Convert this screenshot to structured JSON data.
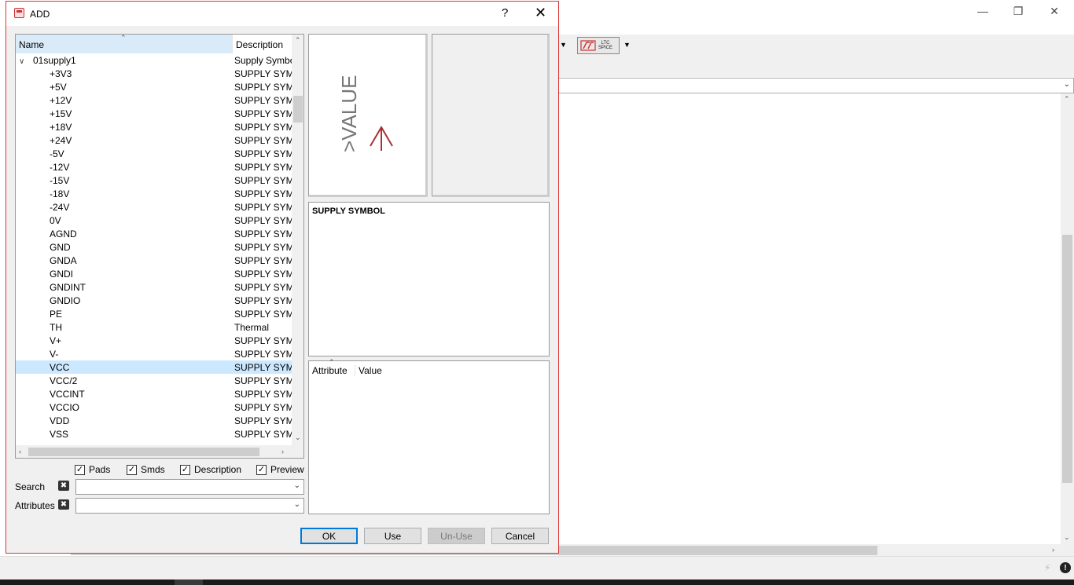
{
  "dialog": {
    "title": "ADD",
    "help_label": "?",
    "close_label": "✕"
  },
  "tree": {
    "columns": {
      "name": "Name",
      "description": "Description"
    },
    "root": {
      "name": "01supply1",
      "description": "Supply Symbols"
    },
    "items": [
      {
        "name": "+3V3",
        "description": "SUPPLY SYMBOL"
      },
      {
        "name": "+5V",
        "description": "SUPPLY SYMBOL"
      },
      {
        "name": "+12V",
        "description": "SUPPLY SYMBOL"
      },
      {
        "name": "+15V",
        "description": "SUPPLY SYMBOL"
      },
      {
        "name": "+18V",
        "description": "SUPPLY SYMBOL"
      },
      {
        "name": "+24V",
        "description": "SUPPLY SYMBOL"
      },
      {
        "name": "-5V",
        "description": "SUPPLY SYMBOL"
      },
      {
        "name": "-12V",
        "description": "SUPPLY SYMBOL"
      },
      {
        "name": "-15V",
        "description": "SUPPLY SYMBOL"
      },
      {
        "name": "-18V",
        "description": "SUPPLY SYMBOL"
      },
      {
        "name": "-24V",
        "description": "SUPPLY SYMBOL"
      },
      {
        "name": "0V",
        "description": "SUPPLY SYMBOL"
      },
      {
        "name": "AGND",
        "description": "SUPPLY SYMBOL"
      },
      {
        "name": "GND",
        "description": "SUPPLY SYMBOL"
      },
      {
        "name": "GNDA",
        "description": "SUPPLY SYMBOL"
      },
      {
        "name": "GNDI",
        "description": "SUPPLY SYMBOL"
      },
      {
        "name": "GNDINT",
        "description": "SUPPLY SYMBOL"
      },
      {
        "name": "GNDIO",
        "description": "SUPPLY SYMBOL"
      },
      {
        "name": "PE",
        "description": "SUPPLY SYMBOL"
      },
      {
        "name": "TH",
        "description": "Thermal"
      },
      {
        "name": "V+",
        "description": "SUPPLY SYMBOL"
      },
      {
        "name": "V-",
        "description": "SUPPLY SYMBOL"
      },
      {
        "name": "VCC",
        "description": "SUPPLY SYMBOL",
        "selected": true
      },
      {
        "name": "VCC/2",
        "description": "SUPPLY SYMBOL"
      },
      {
        "name": "VCCINT",
        "description": "SUPPLY SYMBOL"
      },
      {
        "name": "VCCIO",
        "description": "SUPPLY SYMBOL"
      },
      {
        "name": "VDD",
        "description": "SUPPLY SYMBOL"
      },
      {
        "name": "VSS",
        "description": "SUPPLY SYMBOL"
      }
    ]
  },
  "preview": {
    "symbol_text": ">VALUE",
    "symbol_color": "#a83232",
    "text_color": "#777777"
  },
  "description_text": "SUPPLY SYMBOL",
  "attributes": {
    "col_attribute": "Attribute",
    "col_value": "Value"
  },
  "options": {
    "pads": {
      "label": "Pads",
      "checked": true
    },
    "smds": {
      "label": "Smds",
      "checked": true
    },
    "description": {
      "label": "Description",
      "checked": true
    },
    "preview": {
      "label": "Preview",
      "checked": true
    }
  },
  "search": {
    "label": "Search",
    "value": ""
  },
  "attributes_filter": {
    "label": "Attributes",
    "value": ""
  },
  "buttons": {
    "ok": "OK",
    "use": "Use",
    "unuse": "Un-Use",
    "cancel": "Cancel"
  },
  "background_app": {
    "toolbar_tool_label_line1": "LTC",
    "toolbar_tool_label_line2": "SPICE"
  },
  "colors": {
    "selection": "#cce8ff",
    "header_highlight": "#d9ebf9",
    "dialog_border": "#dd3333",
    "default_button_border": "#0078d7"
  }
}
